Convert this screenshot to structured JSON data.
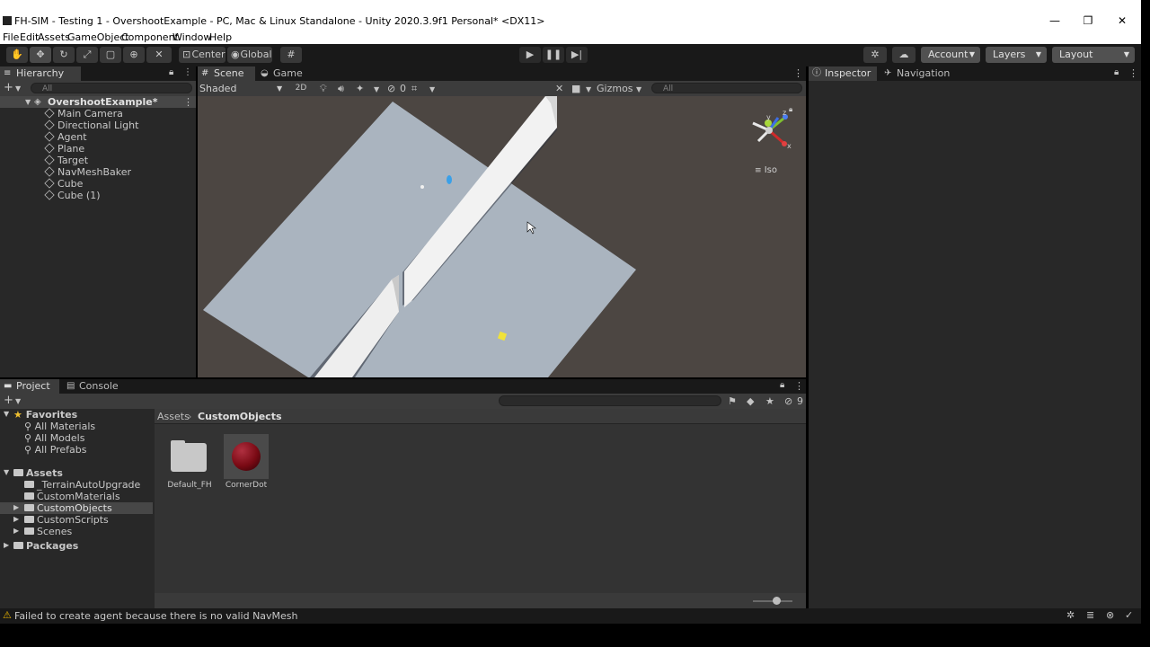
{
  "window": {
    "title": "FH-SIM - Testing 1 - OvershootExample - PC, Mac & Linux Standalone - Unity 2020.3.9f1 Personal* <DX11>",
    "minimize": "—",
    "maximize": "❐",
    "close": "✕"
  },
  "menu": [
    "File",
    "Edit",
    "Assets",
    "GameObject",
    "Component",
    "Window",
    "Help"
  ],
  "toolbar": {
    "pivot_label": "Center",
    "space_label": "Global",
    "account_label": "Account",
    "layers_label": "Layers",
    "layout_label": "Layout"
  },
  "hierarchy": {
    "tab_label": "Hierarchy",
    "search_placeholder": "All",
    "scene_name": "OvershootExample*",
    "items": [
      "Main Camera",
      "Directional Light",
      "Agent",
      "Plane",
      "Target",
      "NavMeshBaker",
      "Cube",
      "Cube (1)"
    ]
  },
  "scene_view": {
    "tabs": [
      "Scene",
      "Game"
    ],
    "shading_mode": "Shaded",
    "mode_2d": "2D",
    "hidden_count": "0",
    "gizmos_label": "Gizmos",
    "search_placeholder": "All",
    "projection_label": "Iso",
    "axis_labels": {
      "x": "x",
      "y": "y",
      "z": "z"
    }
  },
  "inspector": {
    "tabs": [
      "Inspector",
      "Navigation"
    ]
  },
  "project": {
    "tabs": [
      "Project",
      "Console"
    ],
    "favorites_label": "Favorites",
    "favorites": [
      "All Materials",
      "All Models",
      "All Prefabs"
    ],
    "assets_label": "Assets",
    "asset_folders": [
      "_TerrainAutoUpgrade",
      "CustomMaterials",
      "CustomObjects",
      "CustomScripts",
      "Scenes"
    ],
    "packages_label": "Packages",
    "breadcrumb": [
      "Assets",
      "CustomObjects"
    ],
    "hidden_count": "9",
    "grid_items": [
      "Default_FH",
      "CornerDot"
    ]
  },
  "status": {
    "message": "Failed to create agent because there is no valid NavMesh"
  },
  "colors": {
    "editor_bg": "#282828",
    "toolbar_bg": "#191919",
    "scene_bg": "#4c4642",
    "plane": "#aab4bf",
    "warning": "#e8b400",
    "corner_dot": "#7a0a14"
  }
}
